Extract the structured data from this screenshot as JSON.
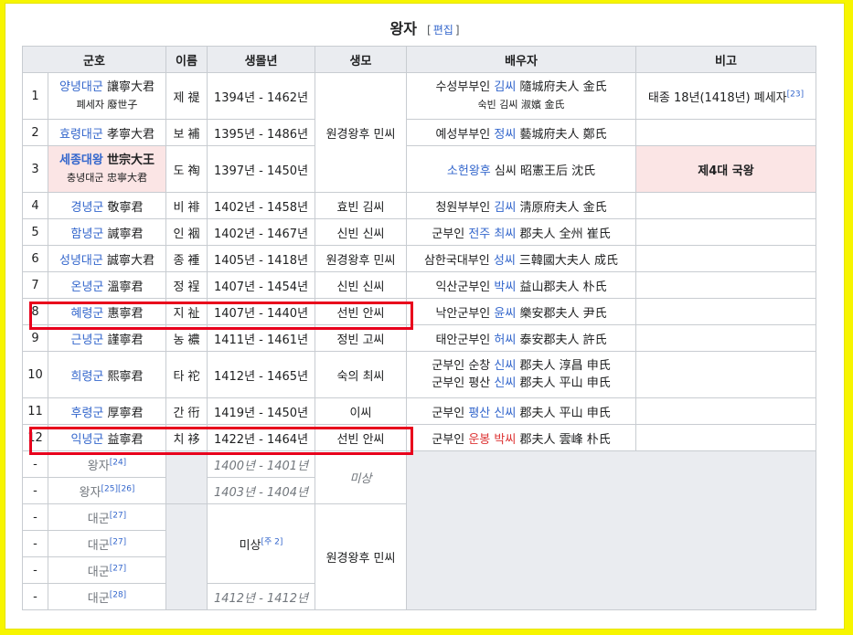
{
  "title": "왕자",
  "edit": {
    "open": "[",
    "label": "편집",
    "close": "]"
  },
  "headers": [
    "군호",
    "이름",
    "생몰년",
    "생모",
    "배우자",
    "비고"
  ],
  "rows": [
    {
      "no": "1",
      "title": "양녕대군",
      "title_hanja": "讓寧大君",
      "title_sub": "폐세자 廢世子",
      "name": "제 禔",
      "years": "1394년 - 1462년",
      "mother": "원경왕후 민씨",
      "spouse": [
        {
          "prefix": "수성부부인 ",
          "link": "김씨",
          "suffix": " 隨城府夫人 金氏"
        },
        {
          "sub": "숙빈 김씨 淑嬪 金氏"
        }
      ],
      "note": "태종 18년(1418년) 폐세자",
      "note_ref": "[23]"
    },
    {
      "no": "2",
      "title": "효령대군",
      "title_hanja": "孝寧大君",
      "name": "보 補",
      "years": "1395년 - 1486년",
      "spouse": [
        {
          "prefix": "예성부부인 ",
          "link": "정씨",
          "suffix": " 藝城府夫人 鄭氏"
        }
      ]
    },
    {
      "no": "3",
      "title": "세종대왕",
      "title_hanja": "世宗大王",
      "title_sub": "충녕대군 忠寧大君",
      "name": "도 祹",
      "years": "1397년 - 1450년",
      "spouse": [
        {
          "link": "소헌왕후",
          "suffix": " 심씨 昭憲王后 沈氏"
        }
      ],
      "note": "제4대 국왕"
    },
    {
      "no": "4",
      "title": "경녕군",
      "title_hanja": "敬寧君",
      "name": "비 裶",
      "years": "1402년 - 1458년",
      "mother": "효빈 김씨",
      "spouse": [
        {
          "prefix": "청원부부인 ",
          "link": "김씨",
          "suffix": " 淸原府夫人 金氏"
        }
      ]
    },
    {
      "no": "5",
      "title": "함녕군",
      "title_hanja": "諴寧君",
      "name": "인 裀",
      "years": "1402년 - 1467년",
      "mother": "신빈 신씨",
      "spouse": [
        {
          "prefix": "군부인 ",
          "link": "전주 최씨",
          "suffix": " 郡夫人 全州 崔氏"
        }
      ]
    },
    {
      "no": "6",
      "title": "성녕대군",
      "title_hanja": "誠寧大君",
      "name": "종 褈",
      "years": "1405년 - 1418년",
      "mother": "원경왕후 민씨",
      "spouse": [
        {
          "prefix": "삼한국대부인 ",
          "link": "성씨",
          "suffix": " 三韓國大夫人 成氏"
        }
      ]
    },
    {
      "no": "7",
      "title": "온녕군",
      "title_hanja": "溫寧君",
      "name": "정 裎",
      "years": "1407년 - 1454년",
      "mother": "신빈 신씨",
      "spouse": [
        {
          "prefix": "익산군부인 ",
          "link": "박씨",
          "suffix": " 益山郡夫人 朴氏"
        }
      ]
    },
    {
      "no": "8",
      "title": "혜령군",
      "title_hanja": "惠寧君",
      "name": "지 祉",
      "years": "1407년 - 1440년",
      "mother": "선빈 안씨",
      "spouse": [
        {
          "prefix": "낙안군부인 ",
          "link": "윤씨",
          "suffix": " 樂安郡夫人 尹氏"
        }
      ]
    },
    {
      "no": "9",
      "title": "근녕군",
      "title_hanja": "謹寧君",
      "name": "농 襛",
      "years": "1411년 - 1461년",
      "mother": "정빈 고씨",
      "spouse": [
        {
          "prefix": "태안군부인 ",
          "link": "허씨",
          "suffix": " 泰安郡夫人 許氏"
        }
      ]
    },
    {
      "no": "10",
      "title": "희령군",
      "title_hanja": "熙寧君",
      "name": "타 袉",
      "years": "1412년 - 1465년",
      "mother": "숙의 최씨",
      "spouse": [
        {
          "prefix": "군부인 순창 ",
          "link": "신씨",
          "suffix": " 郡夫人 淳昌 申氏"
        },
        {
          "prefix": "군부인 평산 ",
          "link": "신씨",
          "suffix": " 郡夫人 平山 申氏"
        }
      ]
    },
    {
      "no": "11",
      "title": "후령군",
      "title_hanja": "厚寧君",
      "name": "간 衎",
      "years": "1419년 - 1450년",
      "mother": "이씨",
      "spouse": [
        {
          "prefix": "군부인 ",
          "link": "평산 신씨",
          "suffix": " 郡夫人 平山 申氏"
        }
      ]
    },
    {
      "no": "12",
      "title": "익녕군",
      "title_hanja": "益寧君",
      "name": "치 袳",
      "years": "1422년 - 1464년",
      "mother": "선빈 안씨",
      "spouse": [
        {
          "prefix": "군부인 ",
          "red": "운봉 박씨",
          "suffix": " 郡夫人 雲峰 朴氏"
        }
      ]
    }
  ],
  "extra": [
    {
      "no": "-",
      "title": "왕자",
      "ref": "[24]",
      "years": "1400년 - 1401년"
    },
    {
      "no": "-",
      "title": "왕자",
      "ref": "[25][26]",
      "years": "1403년 - 1404년"
    },
    {
      "no": "-",
      "title": "대군",
      "ref": "[27]"
    },
    {
      "no": "-",
      "title": "대군",
      "ref": "[27]"
    },
    {
      "no": "-",
      "title": "대군",
      "ref": "[27]"
    },
    {
      "no": "-",
      "title": "대군",
      "ref": "[28]",
      "years": "1412년 - 1412년"
    }
  ],
  "unknown": "미상",
  "unknown_years": "미상",
  "unknown_years_ref": "[주 2]",
  "extra_mother": "원경왕후 민씨",
  "colors": {
    "link": "#3366cc",
    "red_link": "#dd3333",
    "highlight": "#e8001c",
    "king_row": "#fbe5e5",
    "background": "#f7f500"
  }
}
